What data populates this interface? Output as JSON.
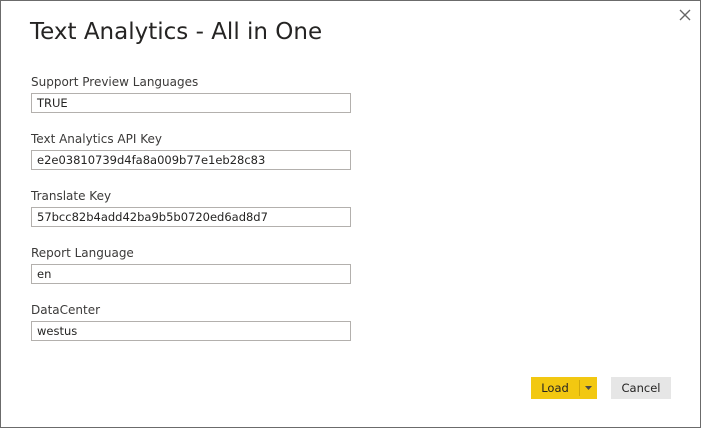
{
  "dialog": {
    "title": "Text Analytics - All in One",
    "close_icon": "close-icon"
  },
  "fields": {
    "preview_languages": {
      "label": "Support Preview Languages",
      "value": "TRUE"
    },
    "api_key": {
      "label": "Text Analytics API Key",
      "value": "e2e03810739d4fa8a009b77e1eb28c83"
    },
    "translate_key": {
      "label": "Translate Key",
      "value": "57bcc82b4add42ba9b5b0720ed6ad8d7"
    },
    "report_language": {
      "label": "Report Language",
      "value": "en"
    },
    "datacenter": {
      "label": "DataCenter",
      "value": "westus"
    }
  },
  "buttons": {
    "load_label": "Load",
    "load_dropdown_icon": "chevron-down-icon",
    "cancel_label": "Cancel"
  },
  "colors": {
    "accent": "#f2c811",
    "cancel_bg": "#e6e6e6",
    "input_border": "#b3b0ad"
  }
}
